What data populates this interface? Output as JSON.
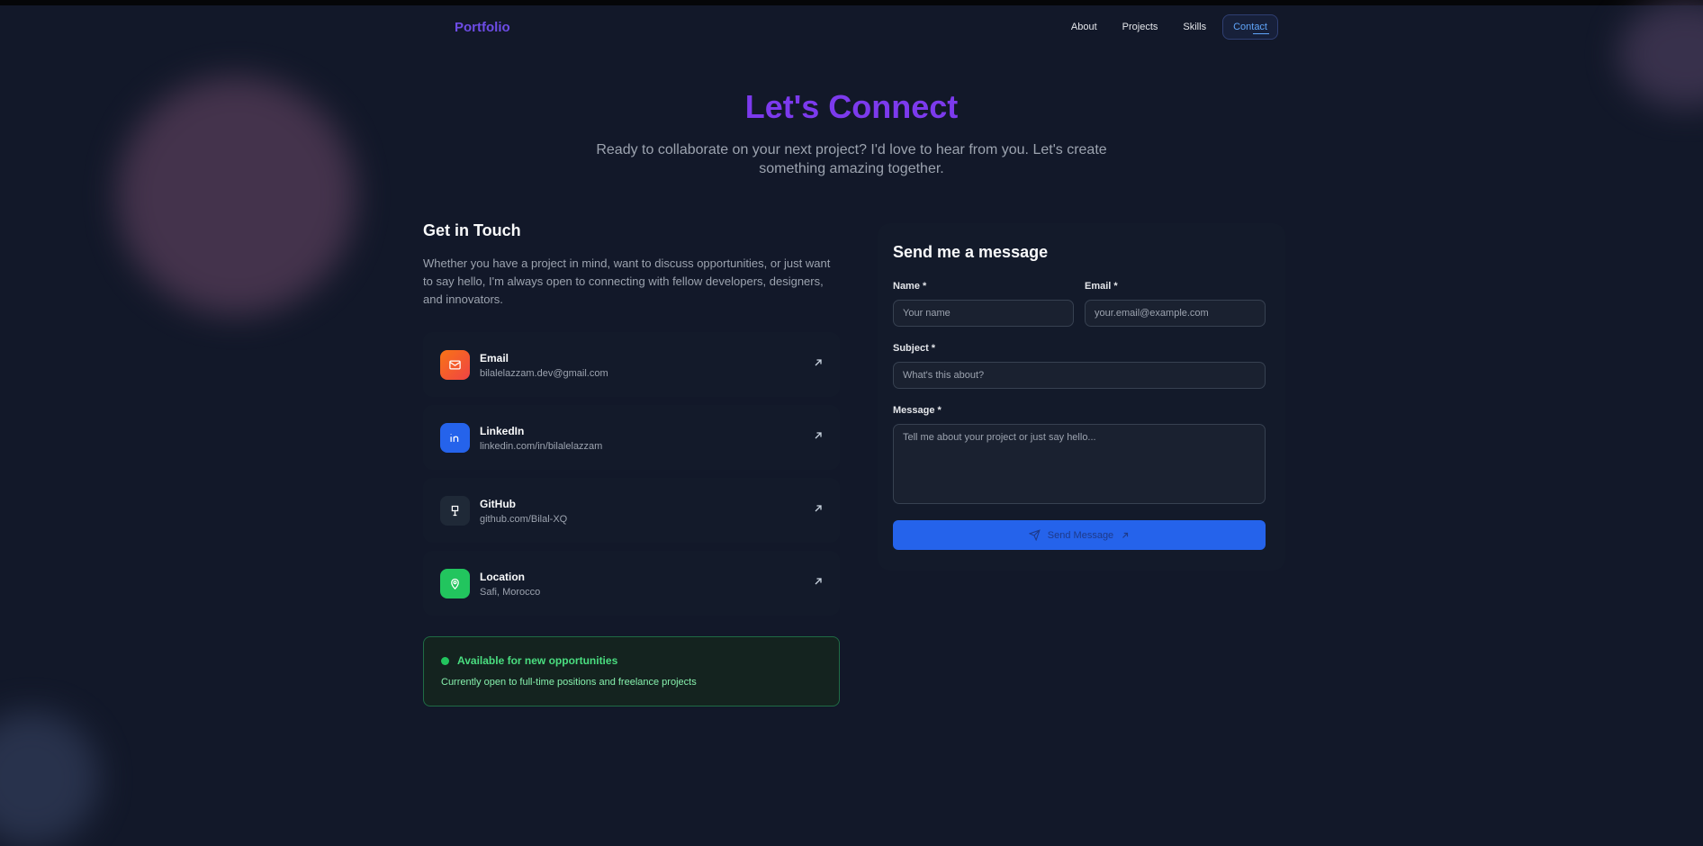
{
  "nav": {
    "brand": "Portfolio",
    "links": [
      {
        "label": "About"
      },
      {
        "label": "Projects"
      },
      {
        "label": "Skills"
      },
      {
        "label": "Contact"
      }
    ]
  },
  "hero": {
    "title": "Let's Connect",
    "subtitle": "Ready to collaborate on your next project? I'd love to hear from you. Let's create something amazing together."
  },
  "contact": {
    "title": "Get in Touch",
    "intro": "Whether you have a project in mind, want to discuss opportunities, or just want to say hello, I'm always open to connecting with fellow developers, designers, and innovators.",
    "items": [
      {
        "title": "Email",
        "value": "bilalelazzam.dev@gmail.com",
        "icon": "mail-icon",
        "color": "#f97316"
      },
      {
        "title": "LinkedIn",
        "value": "linkedin.com/in/bilalelazzam",
        "icon": "linkedin-icon",
        "color": "#2563eb"
      },
      {
        "title": "GitHub",
        "value": "github.com/Bilal-XQ",
        "icon": "github-icon",
        "color": "#1f2937"
      },
      {
        "title": "Location",
        "value": "Safi, Morocco",
        "icon": "map-pin-icon",
        "color": "#22c55e"
      }
    ],
    "status": {
      "title": "Available for new opportunities",
      "text": "Currently open to full-time positions and freelance projects"
    }
  },
  "form": {
    "title": "Send me a message",
    "name_label": "Name *",
    "name_placeholder": "Your name",
    "email_label": "Email *",
    "email_placeholder": "your.email@example.com",
    "subject_label": "Subject *",
    "subject_placeholder": "What's this about?",
    "message_label": "Message *",
    "message_placeholder": "Tell me about your project or just say hello...",
    "submit_label": "Send Message"
  },
  "colors": {
    "accent": "#7c3aed",
    "primary_button": "#2563eb",
    "available": "#22c55e"
  }
}
